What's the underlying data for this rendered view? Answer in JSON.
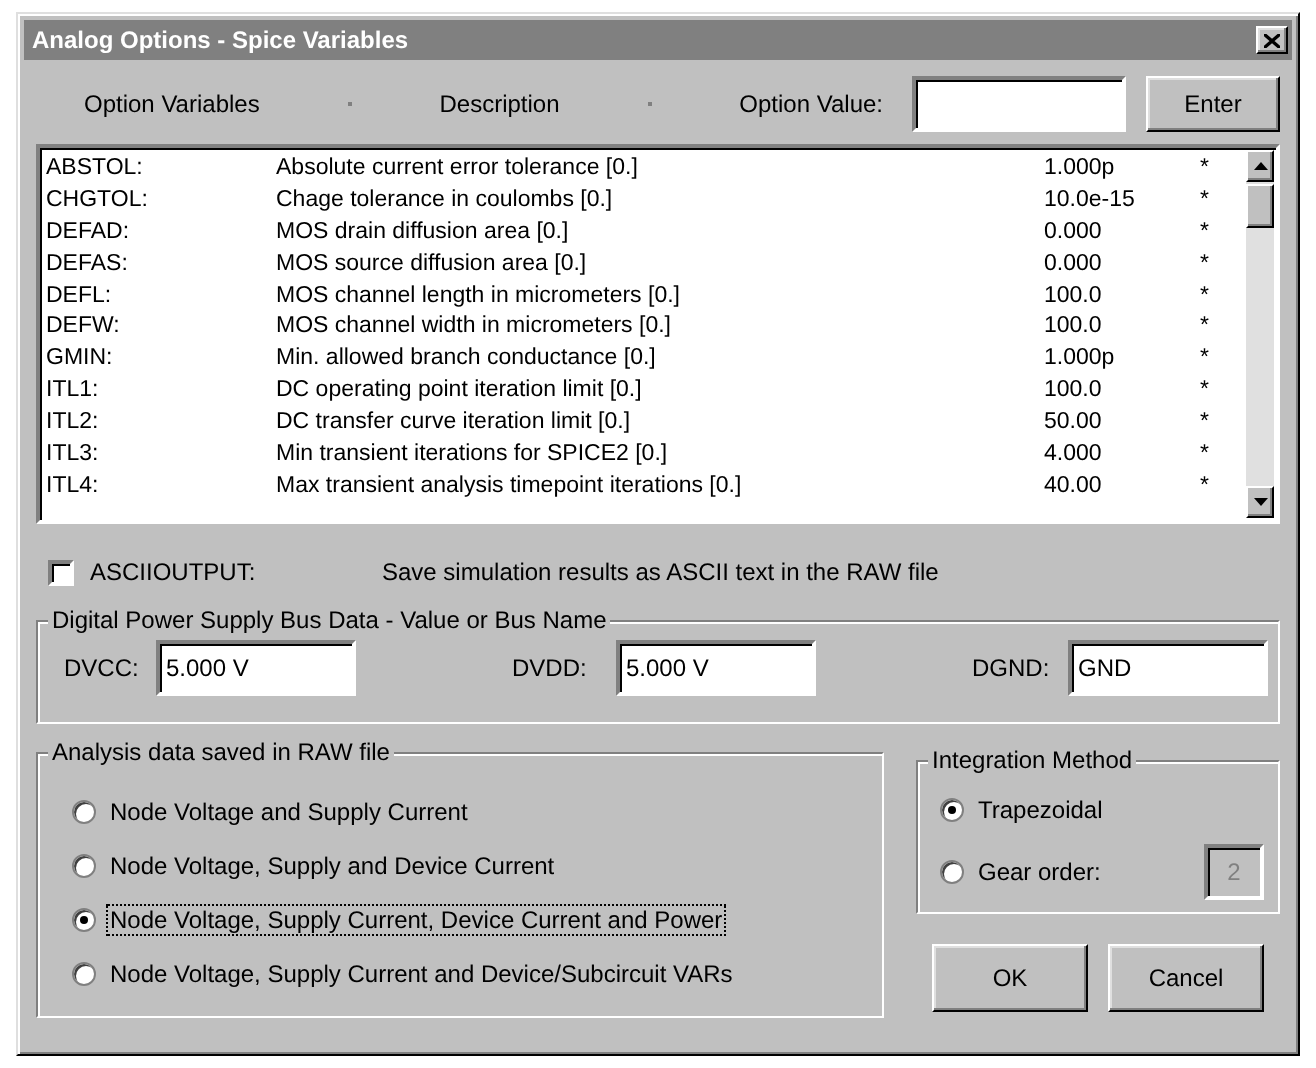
{
  "window": {
    "title": "Analog Options - Spice Variables"
  },
  "header": {
    "labels": [
      "Option Variables",
      "Description",
      "Option Value:"
    ],
    "enter_button": "Enter"
  },
  "options": [
    {
      "name": "ABSTOL:",
      "description": "Absolute current error tolerance [0.]",
      "value": "1.000p",
      "flag": "*"
    },
    {
      "name": "CHGTOL:",
      "description": "Chage tolerance in coulombs [0.]",
      "value": "10.0e-15",
      "flag": "*"
    },
    {
      "name": "DEFAD:",
      "description": "MOS drain diffusion area [0.]",
      "value": "0.000",
      "flag": "*"
    },
    {
      "name": "DEFAS:",
      "description": "MOS source diffusion area [0.]",
      "value": "0.000",
      "flag": "*"
    },
    {
      "name": "DEFL:",
      "description": "MOS channel length in micrometers [0.]",
      "value": "100.0",
      "flag": "*"
    },
    {
      "name": "DEFW:",
      "description": "MOS channel width in micrometers [0.]",
      "value": "100.0",
      "flag": "*"
    },
    {
      "name": "GMIN:",
      "description": "Min. allowed branch conductance [0.]",
      "value": "1.000p",
      "flag": "*"
    },
    {
      "name": "ITL1:",
      "description": "DC operating point iteration limit [0.]",
      "value": "100.0",
      "flag": "*"
    },
    {
      "name": "ITL2:",
      "description": "DC transfer curve iteration limit [0.]",
      "value": "50.00",
      "flag": "*"
    },
    {
      "name": "ITL3:",
      "description": "Min transient iterations for SPICE2 [0.]",
      "value": "4.000",
      "flag": "*"
    },
    {
      "name": "ITL4:",
      "description": "Max transient analysis timepoint iterations [0.]",
      "value": "40.00",
      "flag": "*"
    }
  ],
  "ascii_output": {
    "label": "ASCIIOUTPUT:",
    "checked": false,
    "description": "Save simulation results as ASCII text in the RAW file"
  },
  "digital_power": {
    "title": "Digital Power Supply Bus Data - Value or Bus Name",
    "fields": [
      {
        "label": "DVCC:",
        "value": "5.000 V"
      },
      {
        "label": "DVDD:",
        "value": "5.000 V"
      },
      {
        "label": "DGND:",
        "value": "GND"
      }
    ]
  },
  "analysis": {
    "title": "Analysis data saved in RAW file",
    "options": [
      {
        "label": "Node Voltage and Supply Current",
        "selected": false,
        "focused": false
      },
      {
        "label": "Node Voltage, Supply and Device Current",
        "selected": false,
        "focused": false
      },
      {
        "label": "Node Voltage, Supply Current, Device Current and Power",
        "selected": true,
        "focused": true
      },
      {
        "label": "Node Voltage, Supply Current and Device/Subcircuit VARs",
        "selected": false,
        "focused": false
      }
    ]
  },
  "integration": {
    "title": "Integration Method",
    "options": [
      {
        "label": "Trapezoidal",
        "selected": true
      },
      {
        "label": "Gear order:",
        "selected": false
      }
    ],
    "gear_order": {
      "value": "2",
      "disabled": true
    }
  },
  "buttons": [
    "OK",
    "Cancel"
  ]
}
